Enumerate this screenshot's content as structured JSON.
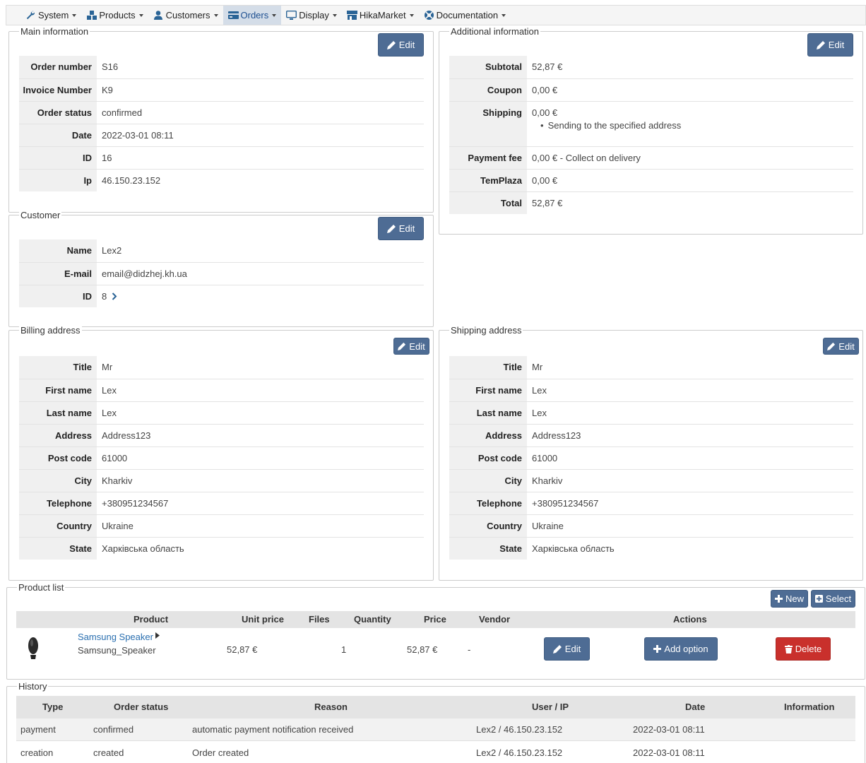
{
  "menu": [
    {
      "label": "System",
      "icon": "wrench-icon"
    },
    {
      "label": "Products",
      "icon": "cubes-icon"
    },
    {
      "label": "Customers",
      "icon": "user-icon"
    },
    {
      "label": "Orders",
      "icon": "credit-card-icon",
      "active": true
    },
    {
      "label": "Display",
      "icon": "desktop-icon"
    },
    {
      "label": "HikaMarket",
      "icon": "store-icon"
    },
    {
      "label": "Documentation",
      "icon": "life-ring-icon"
    }
  ],
  "edit_label": "Edit",
  "main": {
    "legend": "Main information",
    "rows": [
      {
        "k": "Order number",
        "v": "S16"
      },
      {
        "k": "Invoice Number",
        "v": "K9"
      },
      {
        "k": "Order status",
        "v": "confirmed"
      },
      {
        "k": "Date",
        "v": "2022-03-01 08:11"
      },
      {
        "k": "ID",
        "v": "16"
      },
      {
        "k": "Ip",
        "v": "46.150.23.152"
      }
    ]
  },
  "additional": {
    "legend": "Additional information",
    "subtotal_k": "Subtotal",
    "subtotal_v": "52,87 €",
    "coupon_k": "Coupon",
    "coupon_v": "0,00 €",
    "shipping_k": "Shipping",
    "shipping_v": "0,00 €",
    "shipping_note": "Sending to the specified address",
    "payment_k": "Payment fee",
    "payment_v": "0,00 € - Collect on delivery",
    "temp_k": "TemPlaza",
    "temp_v": "0,00 €",
    "total_k": "Total",
    "total_v": "52,87 €"
  },
  "customer": {
    "legend": "Customer",
    "name_k": "Name",
    "name_v": "Lex2",
    "email_k": "E-mail",
    "email_v": "email@didzhej.kh.ua",
    "id_k": "ID",
    "id_v": "8"
  },
  "billing": {
    "legend": "Billing address",
    "rows": [
      {
        "k": "Title",
        "v": "Mr"
      },
      {
        "k": "First name",
        "v": "Lex"
      },
      {
        "k": "Last name",
        "v": "Lex"
      },
      {
        "k": "Address",
        "v": "Address123"
      },
      {
        "k": "Post code",
        "v": "61000"
      },
      {
        "k": "City",
        "v": "Kharkiv"
      },
      {
        "k": "Telephone",
        "v": "+380951234567"
      },
      {
        "k": "Country",
        "v": "Ukraine"
      },
      {
        "k": "State",
        "v": "Харківська область"
      }
    ]
  },
  "shipping": {
    "legend": "Shipping address",
    "rows": [
      {
        "k": "Title",
        "v": "Mr"
      },
      {
        "k": "First name",
        "v": "Lex"
      },
      {
        "k": "Last name",
        "v": "Lex"
      },
      {
        "k": "Address",
        "v": "Address123"
      },
      {
        "k": "Post code",
        "v": "61000"
      },
      {
        "k": "City",
        "v": "Kharkiv"
      },
      {
        "k": "Telephone",
        "v": "+380951234567"
      },
      {
        "k": "Country",
        "v": "Ukraine"
      },
      {
        "k": "State",
        "v": "Харківська область"
      }
    ]
  },
  "products": {
    "legend": "Product list",
    "new_label": "New",
    "select_label": "Select",
    "headers": {
      "product": "Product",
      "unit_price": "Unit price",
      "files": "Files",
      "quantity": "Quantity",
      "price": "Price",
      "vendor": "Vendor",
      "actions": "Actions"
    },
    "item": {
      "name": "Samsung Speaker",
      "code": "Samsung_Speaker",
      "unit_price": "52,87 €",
      "quantity": "1",
      "price": "52,87 €",
      "vendor": "-"
    },
    "edit_label": "Edit",
    "add_option_label": "Add option",
    "delete_label": "Delete"
  },
  "history": {
    "legend": "History",
    "headers": {
      "type": "Type",
      "status": "Order status",
      "reason": "Reason",
      "user": "User / IP",
      "date": "Date",
      "info": "Information"
    },
    "rows": [
      {
        "type": "payment",
        "status": "confirmed",
        "reason": "automatic payment notification received",
        "user": "Lex2 / 46.150.23.152",
        "date": "2022-03-01 08:11",
        "info": ""
      },
      {
        "type": "creation",
        "status": "created",
        "reason": "Order created",
        "user": "Lex2 / 46.150.23.152",
        "date": "2022-03-01 08:11",
        "info": ""
      }
    ]
  },
  "colors": {
    "button": "#4e6c94",
    "delete": "#c9302c",
    "active_menu": "#d4dde8",
    "link": "#2a6fb0"
  }
}
